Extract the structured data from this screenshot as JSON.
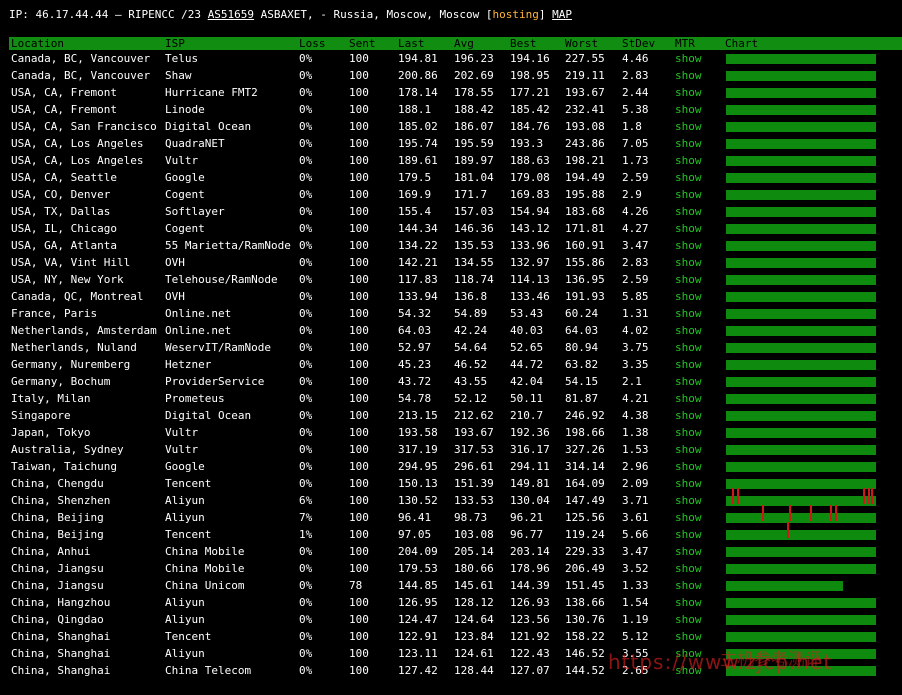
{
  "header": {
    "ip_label": "IP: 46.17.44.44 – RIPENCC /23 ",
    "asn": "AS51659",
    "asn_rest": " ASBAXET, - Russia, Moscow, Moscow [",
    "hosting": "hosting",
    "close_bracket": "] ",
    "map": "MAP"
  },
  "columns": [
    "Location",
    "ISP",
    "Loss",
    "Sent",
    "Last",
    "Avg",
    "Best",
    "Worst",
    "StDev",
    "MTR",
    "Chart"
  ],
  "rows": [
    [
      "Canada, BC, Vancouver",
      "Telus",
      "0%",
      "100",
      "194.81",
      "196.23",
      "194.16",
      "227.55",
      "4.46",
      "show"
    ],
    [
      "Canada, BC, Vancouver",
      "Shaw",
      "0%",
      "100",
      "200.86",
      "202.69",
      "198.95",
      "219.11",
      "2.83",
      "show"
    ],
    [
      "USA, CA, Fremont",
      "Hurricane FMT2",
      "0%",
      "100",
      "178.14",
      "178.55",
      "177.21",
      "193.67",
      "2.44",
      "show"
    ],
    [
      "USA, CA, Fremont",
      "Linode",
      "0%",
      "100",
      "188.1",
      "188.42",
      "185.42",
      "232.41",
      "5.38",
      "show"
    ],
    [
      "USA, CA, San Francisco",
      "Digital Ocean",
      "0%",
      "100",
      "185.02",
      "186.07",
      "184.76",
      "193.08",
      "1.8",
      "show"
    ],
    [
      "USA, CA, Los Angeles",
      "QuadraNET",
      "0%",
      "100",
      "195.74",
      "195.59",
      "193.3",
      "243.86",
      "7.05",
      "show"
    ],
    [
      "USA, CA, Los Angeles",
      "Vultr",
      "0%",
      "100",
      "189.61",
      "189.97",
      "188.63",
      "198.21",
      "1.73",
      "show"
    ],
    [
      "USA, CA, Seattle",
      "Google",
      "0%",
      "100",
      "179.5",
      "181.04",
      "179.08",
      "194.49",
      "2.59",
      "show"
    ],
    [
      "USA, CO, Denver",
      "Cogent",
      "0%",
      "100",
      "169.9",
      "171.7",
      "169.83",
      "195.88",
      "2.9",
      "show"
    ],
    [
      "USA, TX, Dallas",
      "Softlayer",
      "0%",
      "100",
      "155.4",
      "157.03",
      "154.94",
      "183.68",
      "4.26",
      "show"
    ],
    [
      "USA, IL, Chicago",
      "Cogent",
      "0%",
      "100",
      "144.34",
      "146.36",
      "143.12",
      "171.81",
      "4.27",
      "show"
    ],
    [
      "USA, GA, Atlanta",
      "55 Marietta/RamNode",
      "0%",
      "100",
      "134.22",
      "135.53",
      "133.96",
      "160.91",
      "3.47",
      "show"
    ],
    [
      "USA, VA, Vint Hill",
      "OVH",
      "0%",
      "100",
      "142.21",
      "134.55",
      "132.97",
      "155.86",
      "2.83",
      "show"
    ],
    [
      "USA, NY, New York",
      "Telehouse/RamNode",
      "0%",
      "100",
      "117.83",
      "118.74",
      "114.13",
      "136.95",
      "2.59",
      "show"
    ],
    [
      "Canada, QC, Montreal",
      "OVH",
      "0%",
      "100",
      "133.94",
      "136.8",
      "133.46",
      "191.93",
      "5.85",
      "show"
    ],
    [
      "France, Paris",
      "Online.net",
      "0%",
      "100",
      "54.32",
      "54.89",
      "53.43",
      "60.24",
      "1.31",
      "show"
    ],
    [
      "Netherlands, Amsterdam",
      "Online.net",
      "0%",
      "100",
      "64.03",
      "42.24",
      "40.03",
      "64.03",
      "4.02",
      "show"
    ],
    [
      "Netherlands, Nuland",
      "WeservIT/RamNode",
      "0%",
      "100",
      "52.97",
      "54.64",
      "52.65",
      "80.94",
      "3.75",
      "show"
    ],
    [
      "Germany, Nuremberg",
      "Hetzner",
      "0%",
      "100",
      "45.23",
      "46.52",
      "44.72",
      "63.82",
      "3.35",
      "show"
    ],
    [
      "Germany, Bochum",
      "ProviderService",
      "0%",
      "100",
      "43.72",
      "43.55",
      "42.04",
      "54.15",
      "2.1",
      "show"
    ],
    [
      "Italy, Milan",
      "Prometeus",
      "0%",
      "100",
      "54.78",
      "52.12",
      "50.11",
      "81.87",
      "4.21",
      "show"
    ],
    [
      "Singapore",
      "Digital Ocean",
      "0%",
      "100",
      "213.15",
      "212.62",
      "210.7",
      "246.92",
      "4.38",
      "show"
    ],
    [
      "Japan, Tokyo",
      "Vultr",
      "0%",
      "100",
      "193.58",
      "193.67",
      "192.36",
      "198.66",
      "1.38",
      "show"
    ],
    [
      "Australia, Sydney",
      "Vultr",
      "0%",
      "100",
      "317.19",
      "317.53",
      "316.17",
      "327.26",
      "1.53",
      "show"
    ],
    [
      "Taiwan, Taichung",
      "Google",
      "0%",
      "100",
      "294.95",
      "296.61",
      "294.11",
      "314.14",
      "2.96",
      "show"
    ],
    [
      "China, Chengdu",
      "Tencent",
      "0%",
      "100",
      "150.13",
      "151.39",
      "149.81",
      "164.09",
      "2.09",
      "show"
    ],
    [
      "China, Shenzhen",
      "Aliyun",
      "6%",
      "100",
      "130.52",
      "133.53",
      "130.04",
      "147.49",
      "3.71",
      "show"
    ],
    [
      "China, Beijing",
      "Aliyun",
      "7%",
      "100",
      "96.41",
      "98.73",
      "96.21",
      "125.56",
      "3.61",
      "show"
    ],
    [
      "China, Beijing",
      "Tencent",
      "1%",
      "100",
      "97.05",
      "103.08",
      "96.77",
      "119.24",
      "5.66",
      "show"
    ],
    [
      "China, Anhui",
      "China Mobile",
      "0%",
      "100",
      "204.09",
      "205.14",
      "203.14",
      "229.33",
      "3.47",
      "show"
    ],
    [
      "China, Jiangsu",
      "China Mobile",
      "0%",
      "100",
      "179.53",
      "180.66",
      "178.96",
      "206.49",
      "3.52",
      "show"
    ],
    [
      "China, Jiangsu",
      "China Unicom",
      "0%",
      "78",
      "144.85",
      "145.61",
      "144.39",
      "151.45",
      "1.33",
      "show"
    ],
    [
      "China, Hangzhou",
      "Aliyun",
      "0%",
      "100",
      "126.95",
      "128.12",
      "126.93",
      "138.66",
      "1.54",
      "show"
    ],
    [
      "China, Qingdao",
      "Aliyun",
      "0%",
      "100",
      "124.47",
      "124.64",
      "123.56",
      "130.76",
      "1.19",
      "show"
    ],
    [
      "China, Shanghai",
      "Tencent",
      "0%",
      "100",
      "122.91",
      "123.84",
      "121.92",
      "158.22",
      "5.12",
      "show"
    ],
    [
      "China, Shanghai",
      "Aliyun",
      "0%",
      "100",
      "123.11",
      "124.61",
      "122.43",
      "146.52",
      "3.55",
      "show"
    ],
    [
      "China, Shanghai",
      "China Telecom",
      "0%",
      "100",
      "127.42",
      "128.44",
      "127.07",
      "144.52",
      "2.65",
      "show"
    ]
  ],
  "chart_fill": [
    1,
    1,
    1,
    1,
    1,
    1,
    1,
    1,
    1,
    1,
    1,
    1,
    1,
    1,
    1,
    1,
    1,
    1,
    1,
    1,
    1,
    1,
    1,
    1,
    1,
    1,
    1,
    1,
    1,
    1,
    1,
    0.78,
    1,
    1,
    1,
    1,
    1
  ],
  "watermark": "https://www.zjcp.net",
  "watermark2": "主机参考测评"
}
